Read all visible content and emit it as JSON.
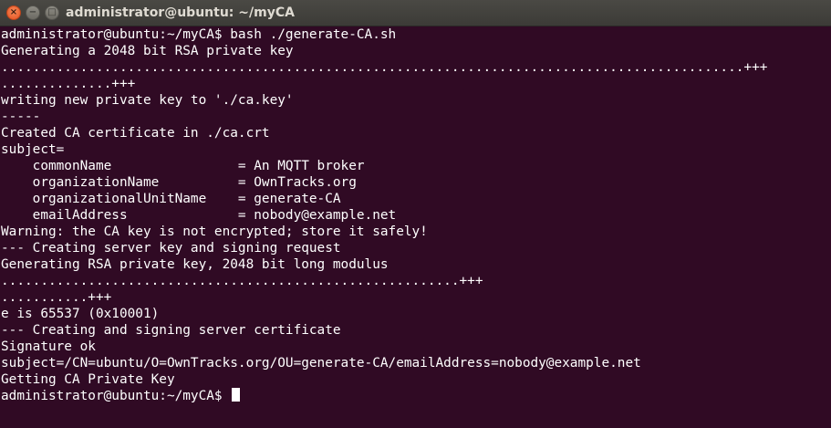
{
  "window": {
    "title": "administrator@ubuntu: ~/myCA",
    "controls": {
      "close_glyph": "×",
      "minimize_glyph": "−",
      "maximize_glyph": "□"
    }
  },
  "terminal": {
    "lines": [
      "administrator@ubuntu:~/myCA$ bash ./generate-CA.sh",
      "Generating a 2048 bit RSA private key",
      "..............................................................................................+++",
      "..............+++",
      "writing new private key to './ca.key'",
      "-----",
      "Created CA certificate in ./ca.crt",
      "subject=",
      "    commonName                = An MQTT broker",
      "    organizationName          = OwnTracks.org",
      "    organizationalUnitName    = generate-CA",
      "    emailAddress              = nobody@example.net",
      "Warning: the CA key is not encrypted; store it safely!",
      "--- Creating server key and signing request",
      "Generating RSA private key, 2048 bit long modulus",
      "..........................................................+++",
      "...........+++",
      "e is 65537 (0x10001)",
      "--- Creating and signing server certificate",
      "Signature ok",
      "subject=/CN=ubuntu/O=OwnTracks.org/OU=generate-CA/emailAddress=nobody@example.net",
      "Getting CA Private Key"
    ],
    "prompt": "administrator@ubuntu:~/myCA$ "
  }
}
